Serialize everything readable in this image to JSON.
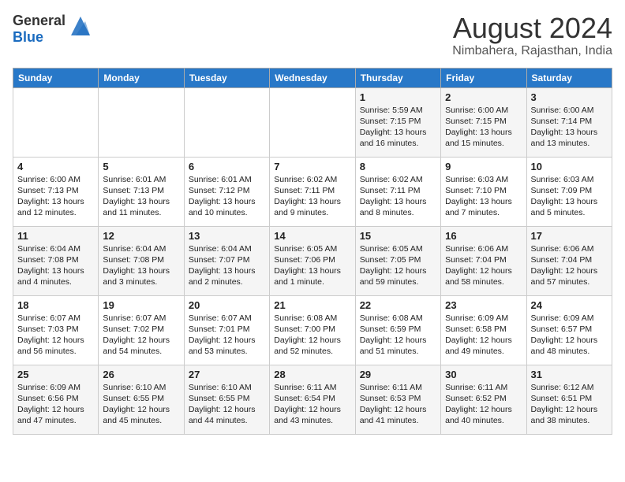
{
  "header": {
    "logo_line1": "General",
    "logo_line2": "Blue",
    "month_year": "August 2024",
    "location": "Nimbahera, Rajasthan, India"
  },
  "days_of_week": [
    "Sunday",
    "Monday",
    "Tuesday",
    "Wednesday",
    "Thursday",
    "Friday",
    "Saturday"
  ],
  "weeks": [
    [
      {
        "day": "",
        "info": ""
      },
      {
        "day": "",
        "info": ""
      },
      {
        "day": "",
        "info": ""
      },
      {
        "day": "",
        "info": ""
      },
      {
        "day": "1",
        "info": "Sunrise: 5:59 AM\nSunset: 7:15 PM\nDaylight: 13 hours and 16 minutes."
      },
      {
        "day": "2",
        "info": "Sunrise: 6:00 AM\nSunset: 7:15 PM\nDaylight: 13 hours and 15 minutes."
      },
      {
        "day": "3",
        "info": "Sunrise: 6:00 AM\nSunset: 7:14 PM\nDaylight: 13 hours and 13 minutes."
      }
    ],
    [
      {
        "day": "4",
        "info": "Sunrise: 6:00 AM\nSunset: 7:13 PM\nDaylight: 13 hours and 12 minutes."
      },
      {
        "day": "5",
        "info": "Sunrise: 6:01 AM\nSunset: 7:13 PM\nDaylight: 13 hours and 11 minutes."
      },
      {
        "day": "6",
        "info": "Sunrise: 6:01 AM\nSunset: 7:12 PM\nDaylight: 13 hours and 10 minutes."
      },
      {
        "day": "7",
        "info": "Sunrise: 6:02 AM\nSunset: 7:11 PM\nDaylight: 13 hours and 9 minutes."
      },
      {
        "day": "8",
        "info": "Sunrise: 6:02 AM\nSunset: 7:11 PM\nDaylight: 13 hours and 8 minutes."
      },
      {
        "day": "9",
        "info": "Sunrise: 6:03 AM\nSunset: 7:10 PM\nDaylight: 13 hours and 7 minutes."
      },
      {
        "day": "10",
        "info": "Sunrise: 6:03 AM\nSunset: 7:09 PM\nDaylight: 13 hours and 5 minutes."
      }
    ],
    [
      {
        "day": "11",
        "info": "Sunrise: 6:04 AM\nSunset: 7:08 PM\nDaylight: 13 hours and 4 minutes."
      },
      {
        "day": "12",
        "info": "Sunrise: 6:04 AM\nSunset: 7:08 PM\nDaylight: 13 hours and 3 minutes."
      },
      {
        "day": "13",
        "info": "Sunrise: 6:04 AM\nSunset: 7:07 PM\nDaylight: 13 hours and 2 minutes."
      },
      {
        "day": "14",
        "info": "Sunrise: 6:05 AM\nSunset: 7:06 PM\nDaylight: 13 hours and 1 minute."
      },
      {
        "day": "15",
        "info": "Sunrise: 6:05 AM\nSunset: 7:05 PM\nDaylight: 12 hours and 59 minutes."
      },
      {
        "day": "16",
        "info": "Sunrise: 6:06 AM\nSunset: 7:04 PM\nDaylight: 12 hours and 58 minutes."
      },
      {
        "day": "17",
        "info": "Sunrise: 6:06 AM\nSunset: 7:04 PM\nDaylight: 12 hours and 57 minutes."
      }
    ],
    [
      {
        "day": "18",
        "info": "Sunrise: 6:07 AM\nSunset: 7:03 PM\nDaylight: 12 hours and 56 minutes."
      },
      {
        "day": "19",
        "info": "Sunrise: 6:07 AM\nSunset: 7:02 PM\nDaylight: 12 hours and 54 minutes."
      },
      {
        "day": "20",
        "info": "Sunrise: 6:07 AM\nSunset: 7:01 PM\nDaylight: 12 hours and 53 minutes."
      },
      {
        "day": "21",
        "info": "Sunrise: 6:08 AM\nSunset: 7:00 PM\nDaylight: 12 hours and 52 minutes."
      },
      {
        "day": "22",
        "info": "Sunrise: 6:08 AM\nSunset: 6:59 PM\nDaylight: 12 hours and 51 minutes."
      },
      {
        "day": "23",
        "info": "Sunrise: 6:09 AM\nSunset: 6:58 PM\nDaylight: 12 hours and 49 minutes."
      },
      {
        "day": "24",
        "info": "Sunrise: 6:09 AM\nSunset: 6:57 PM\nDaylight: 12 hours and 48 minutes."
      }
    ],
    [
      {
        "day": "25",
        "info": "Sunrise: 6:09 AM\nSunset: 6:56 PM\nDaylight: 12 hours and 47 minutes."
      },
      {
        "day": "26",
        "info": "Sunrise: 6:10 AM\nSunset: 6:55 PM\nDaylight: 12 hours and 45 minutes."
      },
      {
        "day": "27",
        "info": "Sunrise: 6:10 AM\nSunset: 6:55 PM\nDaylight: 12 hours and 44 minutes."
      },
      {
        "day": "28",
        "info": "Sunrise: 6:11 AM\nSunset: 6:54 PM\nDaylight: 12 hours and 43 minutes."
      },
      {
        "day": "29",
        "info": "Sunrise: 6:11 AM\nSunset: 6:53 PM\nDaylight: 12 hours and 41 minutes."
      },
      {
        "day": "30",
        "info": "Sunrise: 6:11 AM\nSunset: 6:52 PM\nDaylight: 12 hours and 40 minutes."
      },
      {
        "day": "31",
        "info": "Sunrise: 6:12 AM\nSunset: 6:51 PM\nDaylight: 12 hours and 38 minutes."
      }
    ]
  ]
}
